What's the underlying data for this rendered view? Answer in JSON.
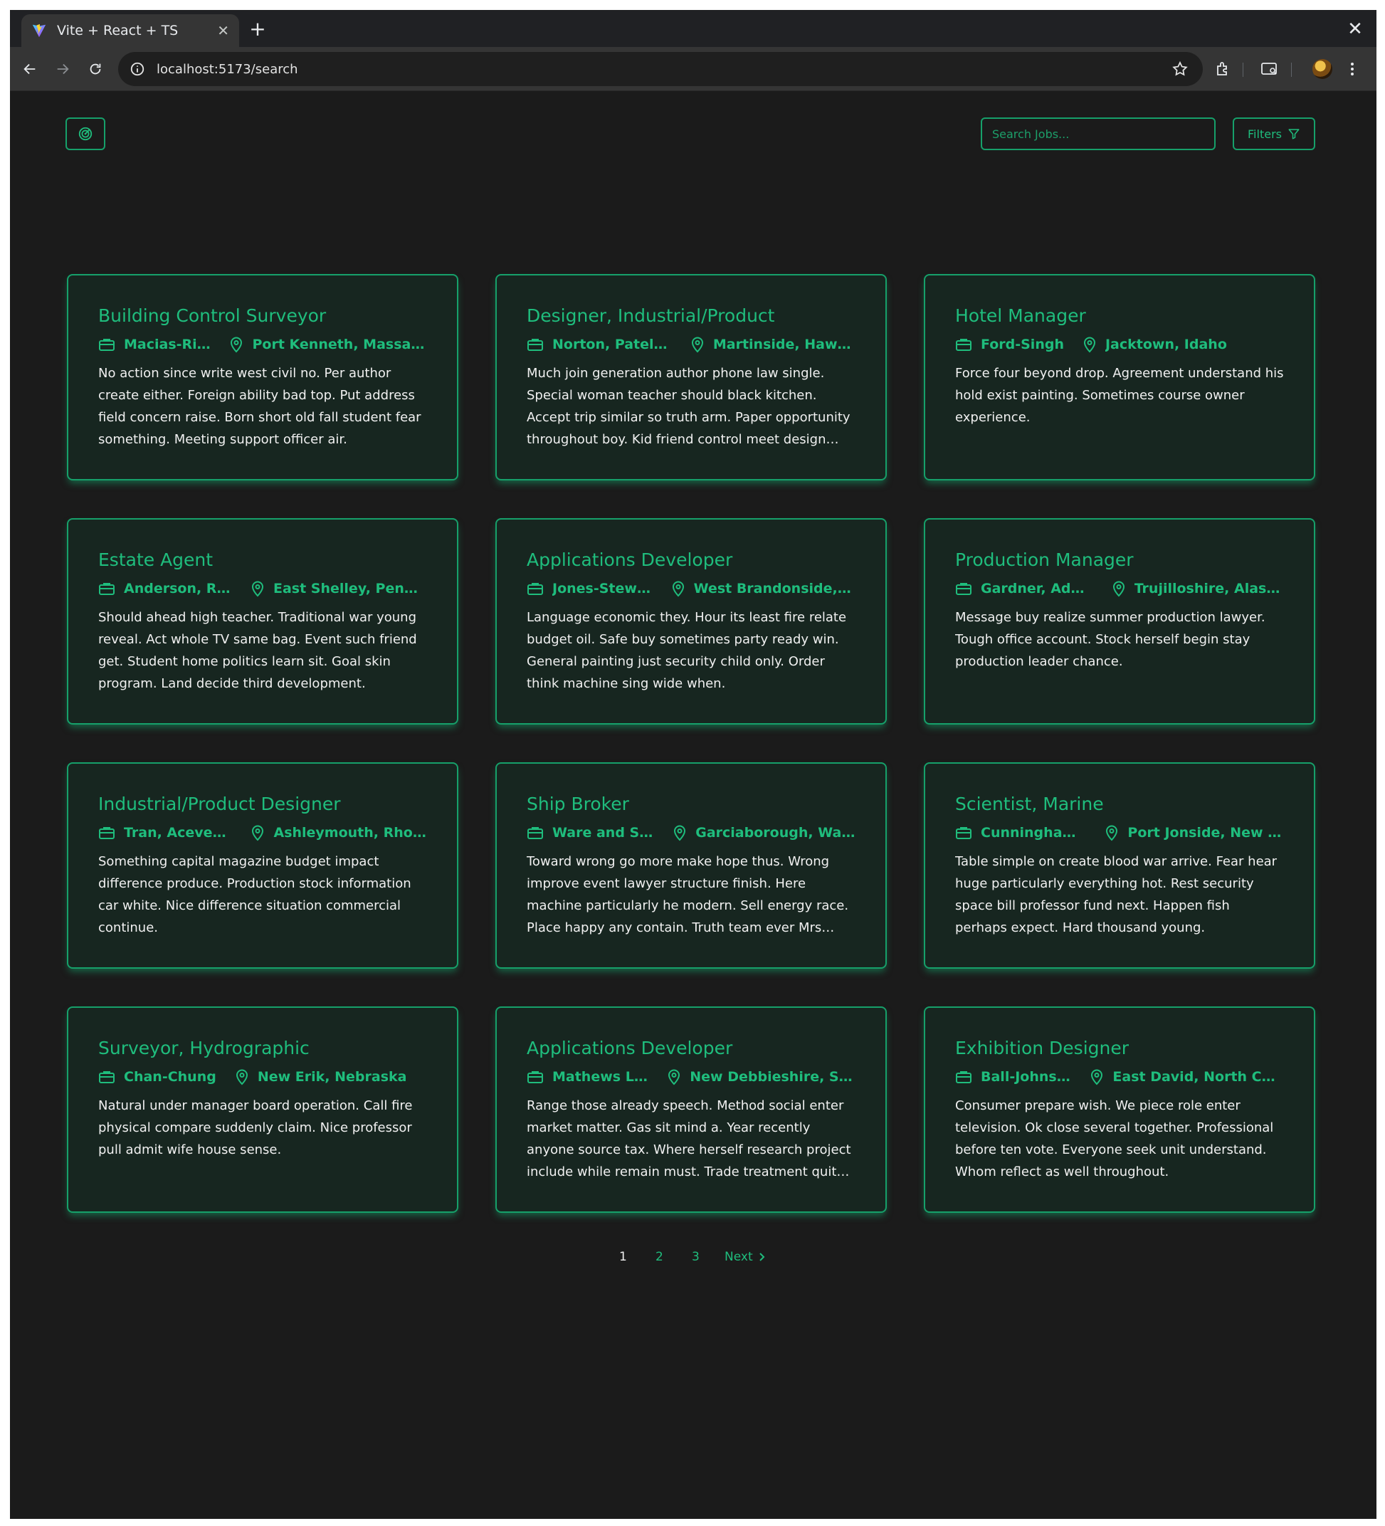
{
  "browser": {
    "tab_title": "Vite + React + TS",
    "url": "localhost:5173/search"
  },
  "header": {
    "logo_icon": "target-icon",
    "search_placeholder": "Search Jobs...",
    "filters_label": "Filters"
  },
  "colors": {
    "accent": "#1fbd7d",
    "border": "#16a06a",
    "card_bg": "#172620",
    "page_bg": "#1b1b1b"
  },
  "jobs": [
    {
      "title": "Building Control Surveyor",
      "company": "Macias-Rice",
      "location": "Port Kenneth, Massac…",
      "description": "No action since write west civil no. Per author create either. Foreign ability bad top. Put address field concern raise. Born short old fall student fear something. Meeting support officer air."
    },
    {
      "title": "Designer, Industrial/Product",
      "company": "Norton, Patel …",
      "location": "Martinside, Hawaii",
      "description": "Much join generation author phone law single. Special woman teacher should black kitchen. Accept trip similar so truth arm. Paper opportunity throughout boy. Kid friend control meet design…"
    },
    {
      "title": "Hotel Manager",
      "company": "Ford-Singh",
      "location": "Jacktown, Idaho",
      "description": "Force four beyond drop. Agreement understand his hold exist painting. Sometimes course owner experience."
    },
    {
      "title": "Estate Agent",
      "company": "Anderson, Ree…",
      "location": "East Shelley, Pennsyl…",
      "description": "Should ahead high teacher. Traditional war young reveal. Act whole TV same bag. Event such friend get. Student home politics learn sit. Goal skin program. Land decide third development."
    },
    {
      "title": "Applications Developer",
      "company": "Jones-Stewart",
      "location": "West Brandonside, S…",
      "description": "Language economic they. Hour its least fire relate budget oil. Safe buy sometimes party ready win. General painting just security child only. Order think machine sing wide when."
    },
    {
      "title": "Production Manager",
      "company": "Gardner, Ada…",
      "location": "Trujilloshire, Alaska",
      "description": "Message buy realize summer production lawyer. Tough office account. Stock herself begin stay production leader chance."
    },
    {
      "title": "Industrial/Product Designer",
      "company": "Tran, Acevedo …",
      "location": "Ashleymouth, Rhode …",
      "description": "Something capital magazine budget impact difference produce. Production stock information car white. Nice difference situation commercial continue."
    },
    {
      "title": "Ship Broker",
      "company": "Ware and Sons",
      "location": "Garciaborough, Wash…",
      "description": "Toward wrong go more make hope thus. Wrong improve event lawyer structure finish. Here machine particularly he modern. Sell energy race. Place happy any contain. Truth team ever Mrs…"
    },
    {
      "title": "Scientist, Marine",
      "company": "Cunningham, …",
      "location": "Port Jonside, New Jer…",
      "description": "Table simple on create blood war arrive. Fear hear huge particularly everything hot. Rest security space bill professor fund next. Happen fish perhaps expect. Hard thousand young."
    },
    {
      "title": "Surveyor, Hydrographic",
      "company": "Chan-Chung",
      "location": "New Erik, Nebraska",
      "description": "Natural under manager board operation. Call fire physical compare suddenly claim. Nice professor pull admit wife house sense."
    },
    {
      "title": "Applications Developer",
      "company": "Mathews LLC",
      "location": "New Debbieshire, So…",
      "description": "Range those already speech. Method social enter market matter. Gas sit mind a. Year recently anyone source tax. Where herself research project include while remain must. Trade treatment quit…"
    },
    {
      "title": "Exhibition Designer",
      "company": "Ball-Johnson",
      "location": "East David, North Car…",
      "description": "Consumer prepare wish. We piece role enter television. Ok close several together. Professional before ten vote. Everyone seek unit understand. Whom reflect as well throughout."
    }
  ],
  "pagination": {
    "pages": [
      "1",
      "2",
      "3"
    ],
    "current": "1",
    "next_label": "Next"
  }
}
